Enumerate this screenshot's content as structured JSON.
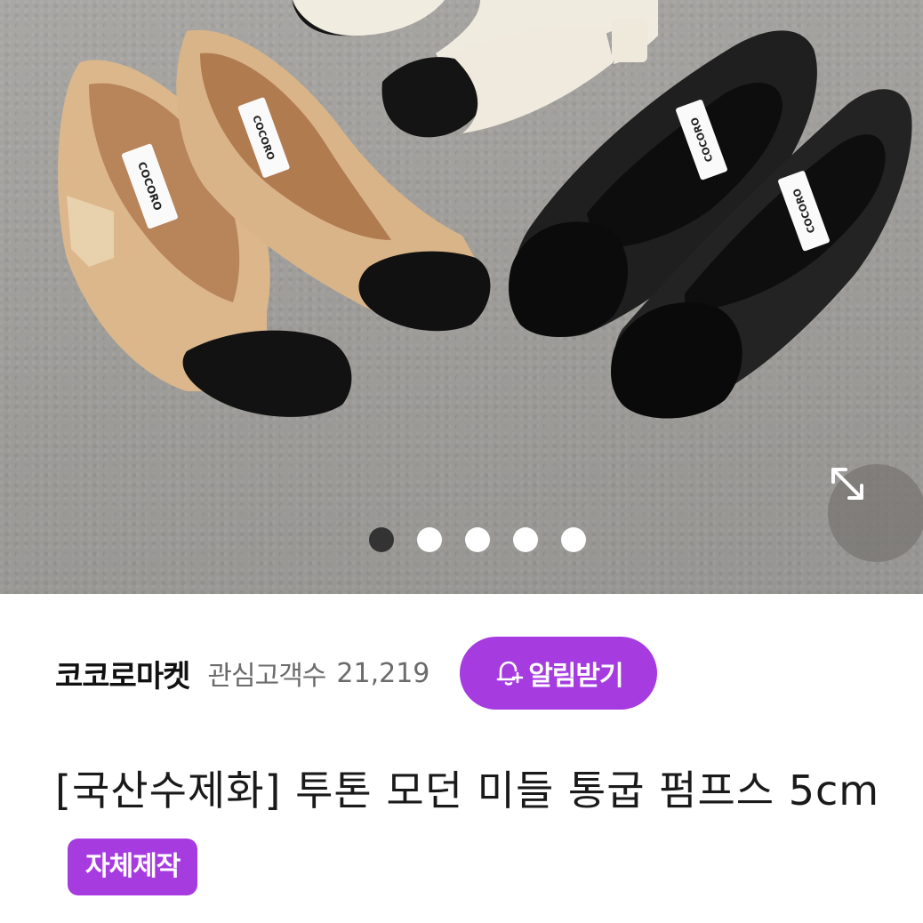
{
  "gallery": {
    "current_index": 1,
    "total": 5,
    "brand_label": "COCORO"
  },
  "seller": {
    "name": "코코로마켓",
    "interest_label": "관심고객수",
    "interest_count": "21,219",
    "notify_label": "알림받기"
  },
  "product": {
    "title": "[국산수제화] 투톤 모던 미들 통굽 펌프스 5cm",
    "badge": "자체제작"
  },
  "colors": {
    "accent": "#a63be0",
    "dot_active": "#333333",
    "dot_inactive": "#ffffff"
  }
}
